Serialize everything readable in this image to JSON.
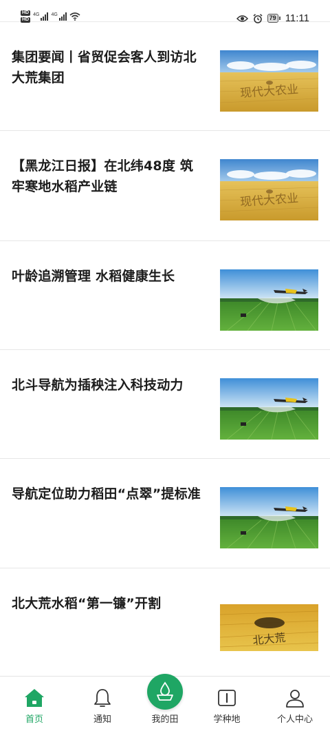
{
  "status_bar": {
    "hd1": "HD",
    "hd2": "HD",
    "net1": "4G",
    "net2": "4G",
    "battery": "79",
    "time": "11:11",
    "icons": [
      "eye-icon",
      "alarm-icon"
    ]
  },
  "news": [
    {
      "title": "集团要闻丨省贸促会客人到访北大荒集团",
      "image": "wheat-field-logo"
    },
    {
      "title": "【黑龙江日报】在北纬48度 筑牢寒地水稻产业链",
      "image": "wheat-field-logo"
    },
    {
      "title": "叶龄追溯管理 水稻健康生长",
      "image": "crop-duster-plane"
    },
    {
      "title": "北斗导航为插秧注入科技动力",
      "image": "crop-duster-plane"
    },
    {
      "title": "导航定位助力稻田“点翠”提标准",
      "image": "crop-duster-plane"
    },
    {
      "title": "北大荒水稻“第一镰”开割",
      "image": "rice-field-beidahuang"
    }
  ],
  "image_text": {
    "field_logo": "现代大农业",
    "bdh_logo": "北大荒"
  },
  "tabs": [
    {
      "label": "首页",
      "icon": "home-icon",
      "active": true
    },
    {
      "label": "通知",
      "icon": "bell-icon",
      "active": false
    },
    {
      "label": "我的田",
      "icon": "field-drop-icon",
      "active": false
    },
    {
      "label": "学种地",
      "icon": "book-icon",
      "active": false
    },
    {
      "label": "个人中心",
      "icon": "user-icon",
      "active": false
    }
  ],
  "colors": {
    "accent": "#1fa664",
    "field_gold": "#d9ad3a",
    "field_green": "#4f9a2e",
    "sky": "#4f95d6"
  }
}
